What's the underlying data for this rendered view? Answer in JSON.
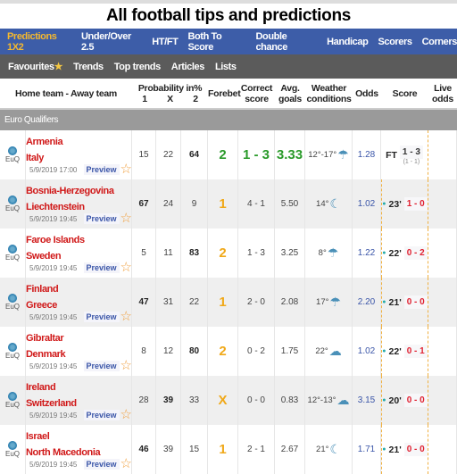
{
  "title": "All football tips and predictions",
  "nav_primary": [
    "Predictions 1X2",
    "Under/Over 2.5",
    "HT/FT",
    "Both To Score",
    "Double chance",
    "Handicap",
    "Scorers",
    "Corners"
  ],
  "nav_secondary": [
    "Favourites",
    "Trends",
    "Top trends",
    "Articles",
    "Lists"
  ],
  "headers": {
    "teams": "Home team - Away team",
    "probability": "Probability in%",
    "p1": "1",
    "px": "X",
    "p2": "2",
    "forebet": "Forebet",
    "correct": "Correct score",
    "avg": "Avg. goals",
    "weather": "Weather conditions",
    "odds": "Odds",
    "score": "Score",
    "live": "Live odds"
  },
  "league": "Euro Qualifiers",
  "league_badge": "EuQ",
  "preview_label": "Preview",
  "matches": [
    {
      "home": "Armenia",
      "away": "Italy",
      "date": "5/9/2019 17:00",
      "p1": "15",
      "px": "22",
      "p2": "64",
      "forebet": "2",
      "correct": "1 - 3",
      "avg": "3.33",
      "weather": "12°-17°",
      "odds": "1.28",
      "status": "FT",
      "score": "1 - 3",
      "ht": "(1 - 1)",
      "finished": true
    },
    {
      "home": "Bosnia-Herzegovina",
      "away": "Liechtenstein",
      "date": "5/9/2019 19:45",
      "p1": "67",
      "px": "24",
      "p2": "9",
      "forebet": "1",
      "correct": "4 - 1",
      "avg": "5.50",
      "weather": "14°",
      "odds": "1.02",
      "status": "23'",
      "score": "1 - 0"
    },
    {
      "home": "Faroe Islands",
      "away": "Sweden",
      "date": "5/9/2019 19:45",
      "p1": "5",
      "px": "11",
      "p2": "83",
      "forebet": "2",
      "correct": "1 - 3",
      "avg": "3.25",
      "weather": "8°",
      "odds": "1.22",
      "status": "22'",
      "score": "0 - 2"
    },
    {
      "home": "Finland",
      "away": "Greece",
      "date": "5/9/2019 19:45",
      "p1": "47",
      "px": "31",
      "p2": "22",
      "forebet": "1",
      "correct": "2 - 0",
      "avg": "2.08",
      "weather": "17°",
      "odds": "2.20",
      "status": "21'",
      "score": "0 - 0"
    },
    {
      "home": "Gibraltar",
      "away": "Denmark",
      "date": "5/9/2019 19:45",
      "p1": "8",
      "px": "12",
      "p2": "80",
      "forebet": "2",
      "correct": "0 - 2",
      "avg": "1.75",
      "weather": "22°",
      "odds": "1.02",
      "status": "22'",
      "score": "0 - 1"
    },
    {
      "home": "Ireland",
      "away": "Switzerland",
      "date": "5/9/2019 19:45",
      "p1": "28",
      "px": "39",
      "p2": "33",
      "forebet": "X",
      "correct": "0 - 0",
      "avg": "0.83",
      "weather": "12°-13°",
      "odds": "3.15",
      "status": "20'",
      "score": "0 - 0"
    },
    {
      "home": "Israel",
      "away": "North Macedonia",
      "date": "5/9/2019 19:45",
      "p1": "46",
      "px": "39",
      "p2": "15",
      "forebet": "1",
      "correct": "2 - 1",
      "avg": "2.67",
      "weather": "21°",
      "odds": "1.71",
      "status": "21'",
      "score": "0 - 0"
    }
  ],
  "colors": {
    "nav_primary": "#3d5da8",
    "nav_secondary": "#5b5b5b",
    "active_tab": "#f5b82e",
    "team": "#d01818",
    "forebet": "#f0a818",
    "correct": "#2a9a2a"
  }
}
